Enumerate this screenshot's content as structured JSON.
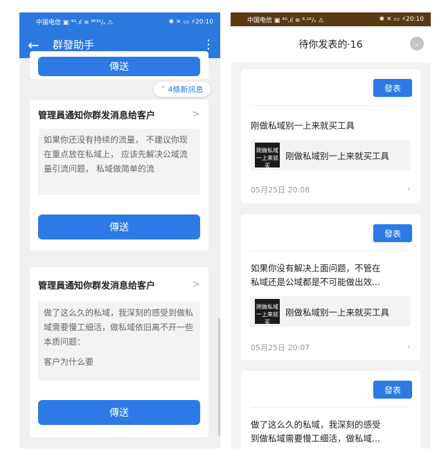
{
  "left": {
    "status": {
      "carrier": "中国电信 ▣ ⁴ᴳ.ıl ≋ ⁸⁶¹ᴷ/ₛ ⚠",
      "right": "✱ ✕ ▭ ⚡20:10"
    },
    "header": {
      "back_icon": "←",
      "title": "群發助手",
      "menu_icon": "⋮"
    },
    "partial_button": "傳送",
    "new_messages": {
      "arrow": "⌃",
      "label": "4條新訊息"
    },
    "cards": [
      {
        "title": "管理員通知你群发消息给客户",
        "body": "如果你还没有持续的流量， 不建议你现在重点放在私域上， 应该先解决公域流量引流问题， 私域做简单的流",
        "button": "傳送"
      },
      {
        "title": "管理員通知你群发消息给客户",
        "body_lines": [
          "做了这么久的私域，我深刻的感受到做私域需要慢工细活，做私域依旧离不开一些本质问题：",
          "客户为什么要"
        ],
        "button": "傳送"
      }
    ]
  },
  "right": {
    "status": {
      "carrier": "中国电信 ▣ ⁴ᴳ.ıl ≋ ⁸⋅¹ᴷ/ₛ ⚠",
      "right": "✱ ✕ ▭ ⚡20:10"
    },
    "sheet": {
      "title": "待你发表的·16",
      "close_icon": "⌄"
    },
    "items": [
      {
        "publish": "發表",
        "text": "刚做私域别一上来就买工具",
        "thumb_lines": [
          "刚做私域",
          "一上来就买"
        ],
        "link_title": "刚做私域别一上来就买工具",
        "time": "05月25日 20:08",
        "chevron": "›"
      },
      {
        "publish": "發表",
        "text_lines": [
          "如果你没有解决上面问题，不管在",
          "私域还是公域都是不可能做出效..."
        ],
        "thumb_lines": [
          "刚做私域",
          "一上来就买"
        ],
        "link_title": "刚做私域别一上来就买工具",
        "time": "05月25日 20:07",
        "chevron": "›"
      },
      {
        "publish": "發表",
        "text_lines": [
          "做了这么久的私域，我深刻的感受",
          "到做私域需要慢工细活，做私域..."
        ]
      }
    ]
  },
  "colors": {
    "primary": "#2b78de",
    "button": "#2b7ae6",
    "status_right": "#5a3a14"
  }
}
